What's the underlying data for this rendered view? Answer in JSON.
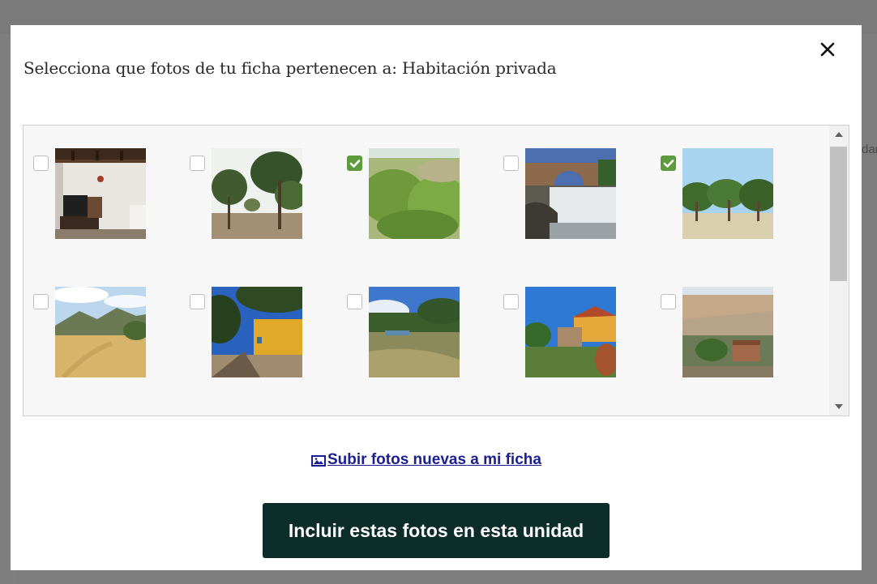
{
  "background": {
    "partial_text": "dar"
  },
  "modal": {
    "title": "Selecciona que fotos de tu ficha pertenecen a: Habitación privada",
    "close_icon": "close-icon",
    "upload_link": {
      "icon": "image-icon",
      "label": "Subir fotos nuevas a mi ficha"
    },
    "primary_button": {
      "label": "Incluir estas fotos en esta unidad"
    }
  },
  "photos": [
    {
      "subject": "interior-room",
      "checked": false
    },
    {
      "subject": "pine-trees",
      "checked": false
    },
    {
      "subject": "green-shrubs",
      "checked": true
    },
    {
      "subject": "stone-bridge-waterfall",
      "checked": false
    },
    {
      "subject": "tree-park",
      "checked": true
    },
    {
      "subject": "mountain-meadow",
      "checked": false
    },
    {
      "subject": "yellow-house-trees",
      "checked": false
    },
    {
      "subject": "river-canal",
      "checked": false
    },
    {
      "subject": "houses-garden",
      "checked": false
    },
    {
      "subject": "aerial-farm",
      "checked": false
    }
  ],
  "colors": {
    "checkbox_checked": "#5e9b3e",
    "button_bg": "#0d2d2b",
    "link": "#1b1f8f"
  }
}
